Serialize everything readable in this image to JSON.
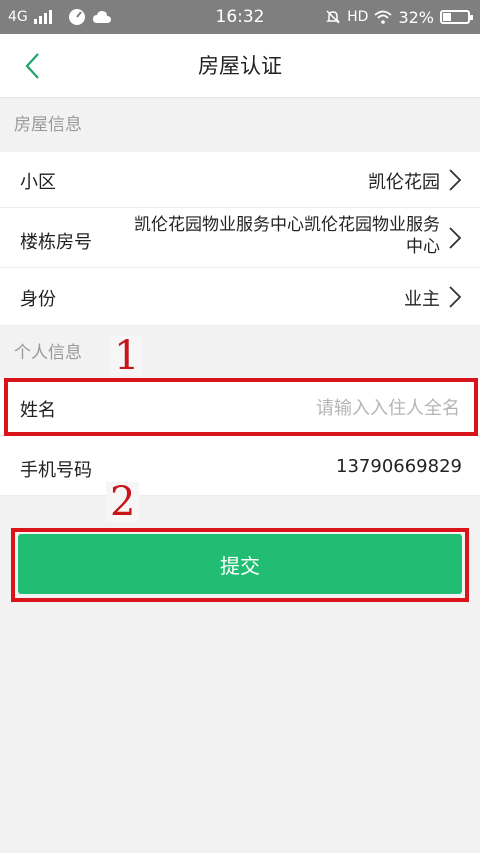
{
  "status_bar": {
    "network": "4G",
    "time": "16:32",
    "hd": "HD",
    "battery": "32%",
    "battery_level": 0.32
  },
  "nav": {
    "title": "房屋认证",
    "back_icon": "chevron-left-icon"
  },
  "house_section": {
    "header": "房屋信息",
    "rows": [
      {
        "label": "小区",
        "value": "凯伦花园"
      },
      {
        "label": "楼栋房号",
        "value_line1": "凯伦花园物业服务中心凯伦花园物业服务",
        "value_line2": "中心"
      },
      {
        "label": "身份",
        "value": "业主"
      }
    ]
  },
  "personal_section": {
    "header": "个人信息",
    "name_label": "姓名",
    "name_placeholder": "请输入入住人全名",
    "phone_label": "手机号码",
    "phone_value": "13790669829"
  },
  "annotations": {
    "marker_1": "1",
    "marker_2": "2",
    "color": "#d9141b"
  },
  "submit": {
    "label": "提交",
    "color": "#20bd73"
  }
}
